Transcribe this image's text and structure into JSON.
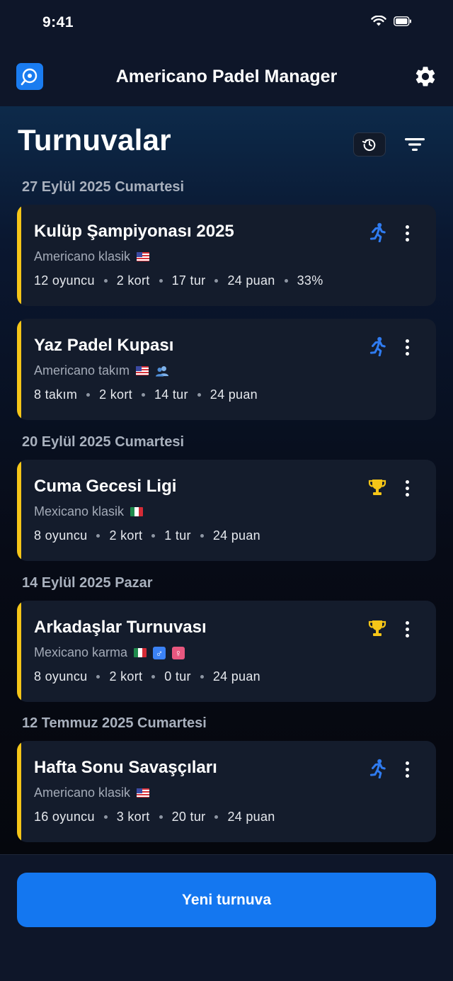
{
  "status_bar": {
    "time": "9:41"
  },
  "header": {
    "title": "Americano Padel Manager"
  },
  "page": {
    "title": "Turnuvalar"
  },
  "groups": [
    {
      "date": "27 Eylül 2025 Cumartesi",
      "cards": [
        {
          "title": "Kulüp Şampiyonası 2025",
          "format": "Americano klasik",
          "stats": [
            "12 oyuncu",
            "2 kort",
            "17 tur",
            "24 puan",
            "33%"
          ],
          "status_icon": "running-icon"
        },
        {
          "title": "Yaz Padel Kupası",
          "format": "Americano takım",
          "stats": [
            "8 takım",
            "2 kort",
            "14 tur",
            "24 puan"
          ],
          "status_icon": "running-icon"
        }
      ]
    },
    {
      "date": "20 Eylül 2025 Cumartesi",
      "cards": [
        {
          "title": "Cuma Gecesi Ligi",
          "format": "Mexicano klasik",
          "stats": [
            "8 oyuncu",
            "2 kort",
            "1 tur",
            "24 puan"
          ],
          "status_icon": "trophy-icon"
        }
      ]
    },
    {
      "date": "14 Eylül 2025 Pazar",
      "cards": [
        {
          "title": "Arkadaşlar Turnuvası",
          "format": "Mexicano karma",
          "stats": [
            "8 oyuncu",
            "2 kort",
            "0 tur",
            "24 puan"
          ],
          "status_icon": "trophy-icon"
        }
      ]
    },
    {
      "date": "12 Temmuz 2025 Cumartesi",
      "cards": [
        {
          "title": "Hafta Sonu Savaşçıları",
          "format": "Americano klasik",
          "stats": [
            "16 oyuncu",
            "3 kort",
            "20 tur",
            "24 puan"
          ],
          "status_icon": "running-icon"
        }
      ]
    }
  ],
  "footer": {
    "new_button_label": "Yeni turnuva"
  },
  "colors": {
    "accent": "#1477f0",
    "card_stripe": "#f5c518",
    "running": "#2f7bf0",
    "trophy": "#f5c518"
  }
}
